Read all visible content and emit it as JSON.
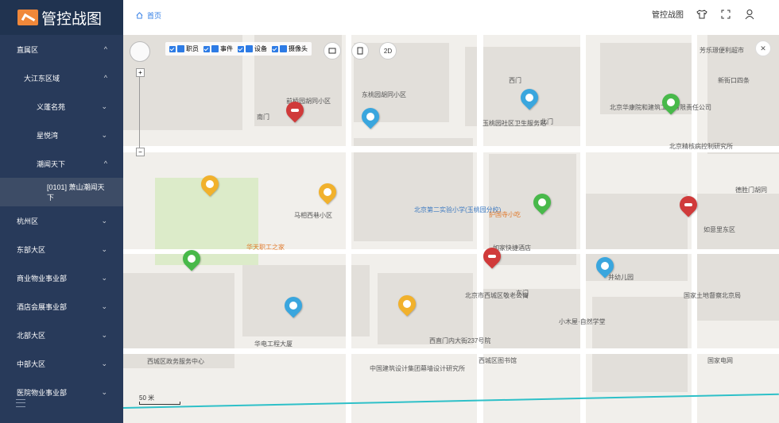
{
  "app": {
    "title": "管控战图"
  },
  "sidebar": {
    "items": [
      {
        "label": "直属区",
        "chev": "^"
      },
      {
        "label": "大江东区域",
        "chev": "^"
      },
      {
        "label": "义蓬名苑",
        "chev": "⌄"
      },
      {
        "label": "星悦湾",
        "chev": "⌄"
      },
      {
        "label": "潮闻天下",
        "chev": "^"
      },
      {
        "label": "[0101] 萧山潮闻天下"
      },
      {
        "label": "杭州区",
        "chev": "⌄"
      },
      {
        "label": "东部大区",
        "chev": "⌄"
      },
      {
        "label": "商业物业事业部",
        "chev": "⌄"
      },
      {
        "label": "酒店会展事业部",
        "chev": "⌄"
      },
      {
        "label": "北部大区",
        "chev": "⌄"
      },
      {
        "label": "中部大区",
        "chev": "⌄"
      },
      {
        "label": "医院物业事业部",
        "chev": "⌄"
      }
    ]
  },
  "topbar": {
    "breadcrumb": "首页",
    "title": "管控战图"
  },
  "map": {
    "filters": [
      {
        "label": "职员"
      },
      {
        "label": "事件"
      },
      {
        "label": "设备"
      },
      {
        "label": "摄像头"
      }
    ],
    "mode_button": "2D",
    "close": "✕",
    "scale": "50 米",
    "labels": [
      "前桥园胡同小区",
      "东桃园胡同小区",
      "玉桃园社区卫生服务站",
      "北京华康院和建筑工程有限责任公司",
      "北京精核病控制研究所",
      "马相西巷小区",
      "北京第二实验小学(玉桃园分校)",
      "护国寺小吃",
      "如家快捷酒店",
      "如意里东区",
      "华天职工之家",
      "西直门内大街237号院",
      "中国建筑设计集团幕墙设计研究所",
      "西城区图书馆",
      "国家土地督察北京局",
      "华电工程大厦",
      "西城区政务服务中心",
      "小木屋·自然学堂",
      "北京市西城区敬老公寓",
      "西门",
      "南门",
      "东门",
      "北门",
      "新街口四条",
      "芳乐璟便利超市",
      "德胜门胡同",
      "井幼儿园",
      "国家电网"
    ]
  }
}
